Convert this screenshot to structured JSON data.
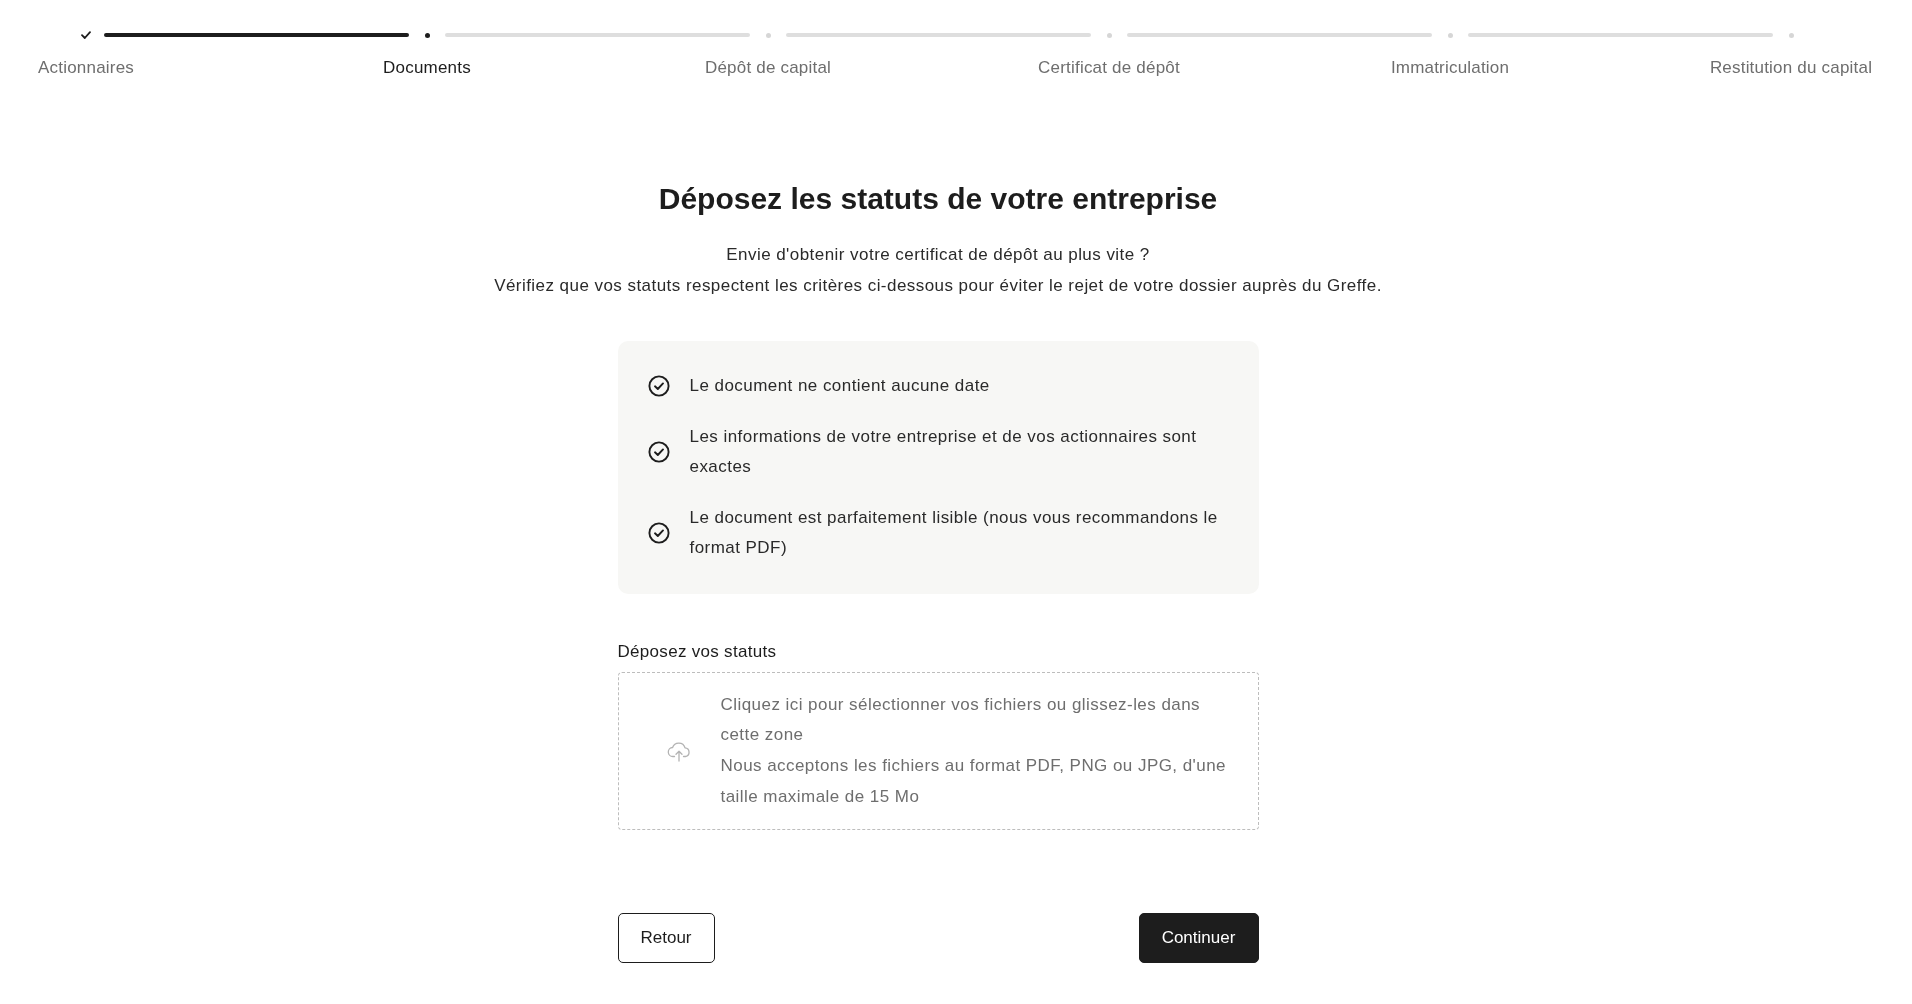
{
  "steps": [
    {
      "label": "Actionnaires",
      "kind": "done"
    },
    {
      "label": "Documents",
      "kind": "current"
    },
    {
      "label": "Dépôt de capital",
      "kind": "upcoming"
    },
    {
      "label": "Certificat de dépôt",
      "kind": "upcoming"
    },
    {
      "label": "Immatriculation",
      "kind": "upcoming"
    },
    {
      "label": "Restitution du capital",
      "kind": "upcoming"
    }
  ],
  "title": "Déposez les statuts de votre entreprise",
  "intro": [
    "Envie d'obtenir votre certificat de dépôt au plus vite ?",
    "Vérifiez que vos statuts respectent les critères ci-dessous pour éviter le rejet de votre dossier auprès du Greffe."
  ],
  "criteria": [
    "Le document ne contient aucune date",
    "Les informations de votre entreprise et de vos actionnaires sont exactes",
    "Le document est parfaitement lisible (nous vous recommandons le format PDF)"
  ],
  "upload": {
    "label": "Déposez vos statuts",
    "prompt": "Cliquez ici pour sélectionner vos fichiers ou glissez-les dans cette zone",
    "hint": "Nous acceptons les fichiers au format PDF, PNG ou JPG, d'une taille maximale de 15 Mo"
  },
  "buttons": [
    {
      "label": "Retour",
      "kind": "secondary"
    },
    {
      "label": "Continuer",
      "kind": "primary"
    }
  ]
}
